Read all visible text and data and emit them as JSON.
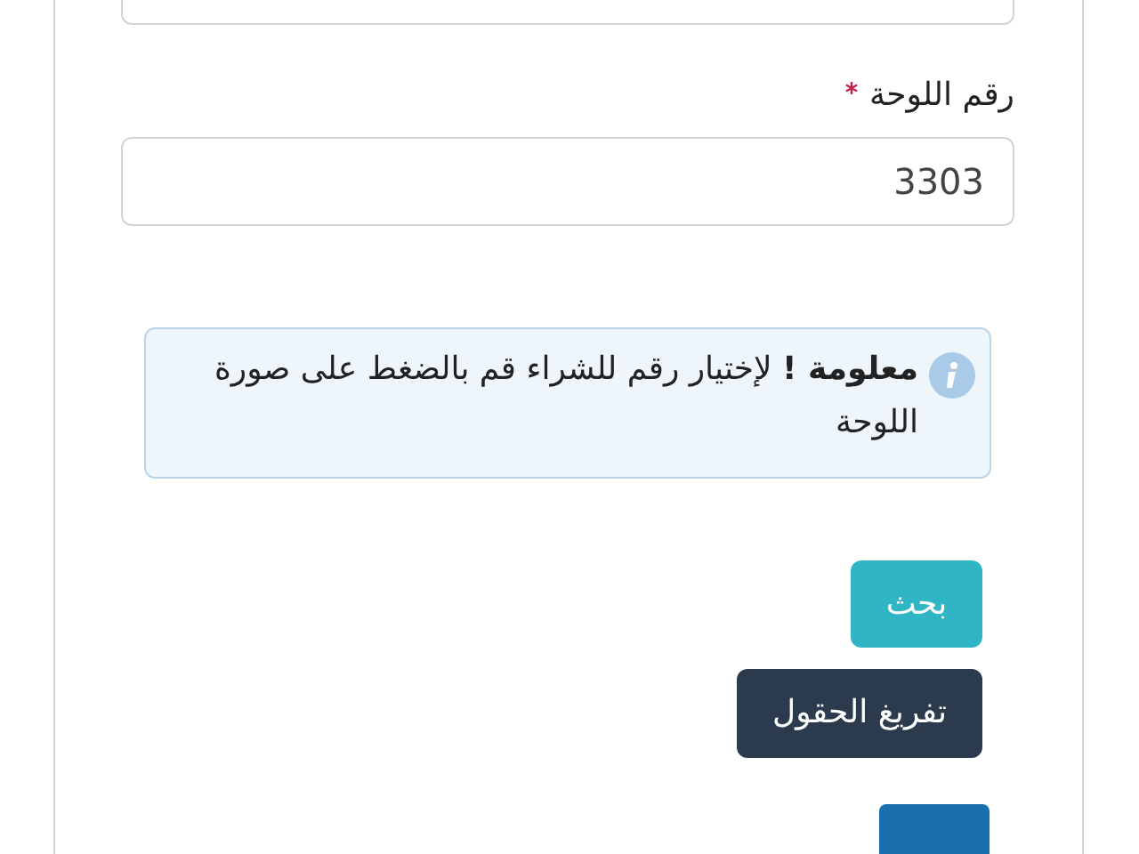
{
  "form": {
    "plate_field": {
      "label": "رقم اللوحة",
      "required": true,
      "value": "3303"
    },
    "alert": {
      "text": "**معلومة !** لإختيار رقم للشراء قم بالضغط على صورة اللوحة"
    },
    "buttons": [
      {
        "label": "بحث",
        "kind": "search"
      },
      {
        "label": "تفريغ الحقول",
        "kind": "clear"
      }
    ]
  }
}
